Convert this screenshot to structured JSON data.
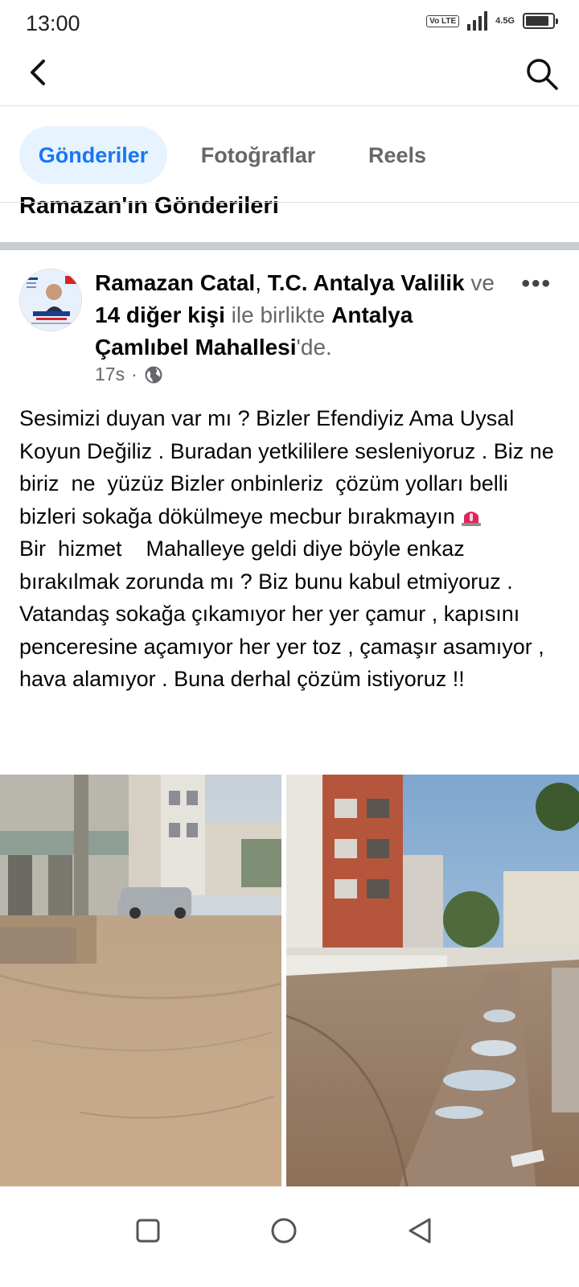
{
  "status_bar": {
    "time": "13:00",
    "volte_label": "Vo LTE",
    "network_label": "4.5G",
    "battery_level_percent": 80
  },
  "header": {
    "back_icon": "chevron-left-icon",
    "search_icon": "search-icon"
  },
  "tabs": [
    {
      "label": "Gönderiler",
      "active": true
    },
    {
      "label": "Fotoğraflar",
      "active": false
    },
    {
      "label": "Reels",
      "active": false
    }
  ],
  "section_title": "Ramazan'ın Gönderileri",
  "post": {
    "author": "Ramazan Catal",
    "separator": ", ",
    "tagged_page": "T.C. Antalya Valilik",
    "with_prefix": "ve",
    "others": "14 diğer kişi",
    "with_suffix": "ile birlikte",
    "location": "Antalya Çamlıbel Mahallesi",
    "location_suffix": "'de.",
    "time": "17s",
    "dot": "·",
    "privacy_icon": "globe-icon",
    "more_label": "•••",
    "text_paragraph_1": "Sesimizi duyan var mı ? Bizler Efendiyiz Ama Uysal Koyun Değiliz . Buradan yetkililere sesleniyoruz . Biz ne biriz  ne  yüzüz Bizler onbinleriz  çözüm yolları belli bizleri sokağa dökülmeye mecbur bırakmayın",
    "emoji_icon": "rotating-light-icon",
    "text_paragraph_2": "Bir  hizmet    Mahalleye geldi diye böyle enkaz bırakılmak zorunda mı ? Biz bunu kabul etmiyoruz . Vatandaş sokağa çıkamıyor her yer çamur , kapısını penceresine açamıyor her yer toz , çamaşır asamıyor , hava alamıyor . Buna derhal çözüm istiyoruz !!",
    "photos": [
      "muddy-street-photo-1",
      "muddy-street-photo-2"
    ]
  },
  "nav_bar": {
    "recents_icon": "square-icon",
    "home_icon": "circle-icon",
    "back_icon": "triangle-back-icon"
  },
  "colors": {
    "accent": "#1877f2",
    "accent_bg": "#e7f3ff",
    "muted_text": "#65676b",
    "divider": "#dadde1",
    "section_gap": "#c9ccd1"
  }
}
